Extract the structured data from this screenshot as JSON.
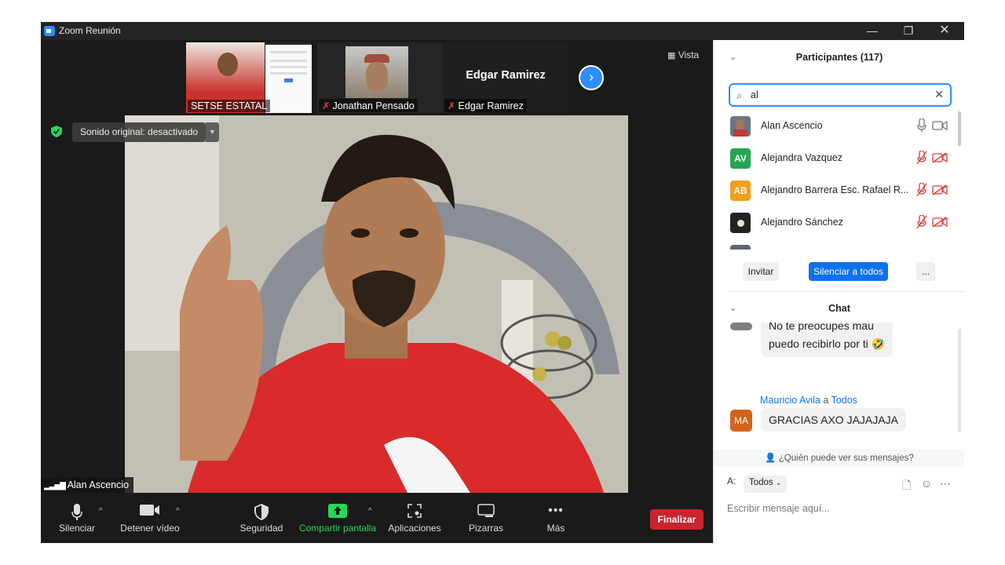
{
  "window": {
    "title": "Zoom Reunión",
    "minimize_icon": "minimize-icon",
    "restore_icon": "restore-icon",
    "close_icon": "close-icon"
  },
  "strip": {
    "tiles": [
      {
        "name": "SETSE ESTATAL",
        "muted": false
      },
      {
        "name": "Jonathan Pensado",
        "muted": true
      },
      {
        "name": "Edgar Ramirez",
        "muted": true,
        "big_name": "Edgar Ramirez"
      }
    ],
    "view_label": "Vista"
  },
  "main_video": {
    "sound_label": "Sonido original: desactivado",
    "speaker": "Alan Ascencio"
  },
  "toolbar": {
    "mute": "Silenciar",
    "video": "Detener vídeo",
    "security": "Seguridad",
    "share": "Compartir pantalla",
    "apps": "Aplicaciones",
    "boards": "Pizarras",
    "more": "Más",
    "end": "Finalizar"
  },
  "participants": {
    "header": "Participantes (117)",
    "search_value": "al",
    "list": [
      {
        "name": "Alan Ascencio",
        "initials": "",
        "color": "#6a7585",
        "mic": "on",
        "cam": "on"
      },
      {
        "name": "Alejandra Vazquez",
        "initials": "AV",
        "color": "#23a650",
        "mic": "muted",
        "cam": "off"
      },
      {
        "name": "Alejandro Barrera Esc. Rafael R...",
        "initials": "AB",
        "color": "#f0a01a",
        "mic": "muted",
        "cam": "off"
      },
      {
        "name": "Alejandro Sánchez",
        "initials": "",
        "color": "#222222",
        "mic": "muted",
        "cam": "off"
      }
    ],
    "invite": "Invitar",
    "mute_all": "Silenciar a todos",
    "more": "..."
  },
  "chat": {
    "header": "Chat",
    "messages": [
      {
        "sender": "",
        "lines": [
          "No te preocupes mau",
          "puedo recibirlo por ti 🤣"
        ]
      },
      {
        "sender": "Mauricio Avila",
        "to_word": "a",
        "to": "Todos",
        "initials": "MA",
        "color": "#d5621a",
        "lines": [
          "GRACIAS  AXO JAJAJAJA"
        ]
      }
    ],
    "who_can": "¿Quién puede ver sus mensajes?",
    "to_label": "A:",
    "to_value": "Todos",
    "placeholder": "Escribir mensaje aquí..."
  },
  "colors": {
    "accent": "#2d8cff",
    "end": "#c8242d",
    "mute_red": "#e03e3e",
    "share_green": "#23d959"
  }
}
